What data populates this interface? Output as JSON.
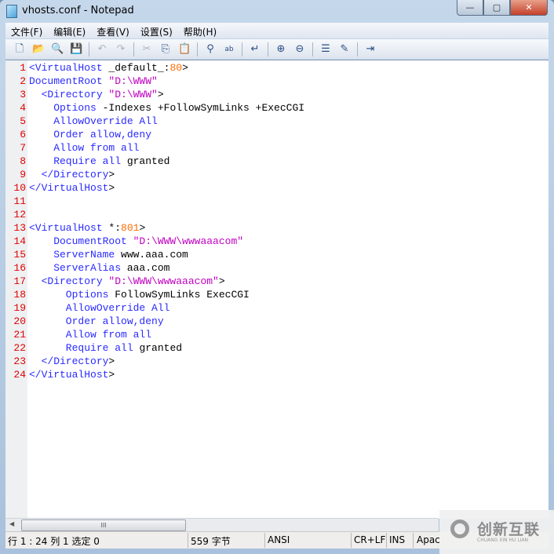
{
  "window": {
    "title": "vhosts.conf - Notepad",
    "controls": {
      "minimize": "—",
      "maximize": "▢",
      "close": "✕"
    }
  },
  "menu": [
    "文件(F)",
    "编辑(E)",
    "查看(V)",
    "设置(S)",
    "帮助(H)"
  ],
  "toolbar": [
    {
      "icon": "new-file-icon",
      "glyph": "🗋"
    },
    {
      "icon": "open-folder-icon",
      "glyph": "📂"
    },
    {
      "icon": "browse-icon",
      "glyph": "🔍"
    },
    {
      "icon": "save-icon",
      "glyph": "💾"
    },
    {
      "sep": true
    },
    {
      "icon": "undo-icon",
      "glyph": "↶"
    },
    {
      "icon": "redo-icon",
      "glyph": "↷"
    },
    {
      "sep": true
    },
    {
      "icon": "cut-icon",
      "glyph": "✂"
    },
    {
      "icon": "copy-icon",
      "glyph": "⎘"
    },
    {
      "icon": "paste-icon",
      "glyph": "📋"
    },
    {
      "sep": true
    },
    {
      "icon": "find-icon",
      "glyph": "⚲"
    },
    {
      "icon": "replace-icon",
      "glyph": "ab"
    },
    {
      "sep": true
    },
    {
      "icon": "goto-icon",
      "glyph": "↵"
    },
    {
      "sep": true
    },
    {
      "icon": "zoom-in-icon",
      "glyph": "⊕"
    },
    {
      "icon": "zoom-out-icon",
      "glyph": "⊖"
    },
    {
      "sep": true
    },
    {
      "icon": "view-icon",
      "glyph": "☰"
    },
    {
      "icon": "settings-icon",
      "glyph": "✎"
    },
    {
      "sep": true
    },
    {
      "icon": "exit-icon",
      "glyph": "⇥"
    }
  ],
  "colors": {
    "b": "#2a2aff",
    "m": "#c000c0",
    "o": "#ff6a00",
    "k": "#000000"
  },
  "lines": [
    [
      [
        "<VirtualHost",
        "b"
      ],
      [
        " _default_:",
        "k"
      ],
      [
        "80",
        "o"
      ],
      [
        ">",
        "k"
      ]
    ],
    [
      [
        "DocumentRoot ",
        "b"
      ],
      [
        "\"D:\\WWW\"",
        "m"
      ]
    ],
    [
      [
        "  <Directory ",
        "b"
      ],
      [
        "\"D:\\WWW\"",
        "m"
      ],
      [
        ">",
        "k"
      ]
    ],
    [
      [
        "    Options ",
        "b"
      ],
      [
        "-Indexes +FollowSymLinks +ExecCGI",
        "k"
      ]
    ],
    [
      [
        "    AllowOverride All",
        "b"
      ]
    ],
    [
      [
        "    Order allow,deny",
        "b"
      ]
    ],
    [
      [
        "    Allow from all",
        "b"
      ]
    ],
    [
      [
        "    Require all ",
        "b"
      ],
      [
        "granted",
        "k"
      ]
    ],
    [
      [
        "  </Directory",
        "b"
      ],
      [
        ">",
        "k"
      ]
    ],
    [
      [
        "</VirtualHost",
        "b"
      ],
      [
        ">",
        "k"
      ]
    ],
    [],
    [],
    [
      [
        "<VirtualHost",
        "b"
      ],
      [
        " *:",
        "k"
      ],
      [
        "801",
        "o"
      ],
      [
        ">",
        "k"
      ]
    ],
    [
      [
        "    DocumentRoot ",
        "b"
      ],
      [
        "\"D:\\WWW\\wwwaaacom\"",
        "m"
      ]
    ],
    [
      [
        "    ServerName ",
        "b"
      ],
      [
        "www.aaa.com",
        "k"
      ]
    ],
    [
      [
        "    ServerAlias ",
        "b"
      ],
      [
        "aaa.com",
        "k"
      ]
    ],
    [
      [
        "  <Directory ",
        "b"
      ],
      [
        "\"D:\\WWW\\wwwaaacom\"",
        "m"
      ],
      [
        ">",
        "k"
      ]
    ],
    [
      [
        "      Options ",
        "b"
      ],
      [
        "FollowSymLinks ExecCGI",
        "k"
      ]
    ],
    [
      [
        "      AllowOverride All",
        "b"
      ]
    ],
    [
      [
        "      Order allow,deny",
        "b"
      ]
    ],
    [
      [
        "      Allow from all",
        "b"
      ]
    ],
    [
      [
        "      Require all ",
        "b"
      ],
      [
        "granted",
        "k"
      ]
    ],
    [
      [
        "  </Directory",
        "b"
      ],
      [
        ">",
        "k"
      ]
    ],
    [
      [
        "</VirtualHost",
        "b"
      ],
      [
        ">",
        "k"
      ]
    ]
  ],
  "scrollbar": {
    "thumb_grip": "III"
  },
  "status": {
    "position": "行 1 : 24   列 1   选定 0",
    "size": "559 字节",
    "encoding": "ANSI",
    "eol": "CR+LF",
    "mode": "INS",
    "lexer": "Apac"
  },
  "watermark": {
    "name": "创新互联",
    "sub": "CHUANG XIN HU LIAN"
  }
}
